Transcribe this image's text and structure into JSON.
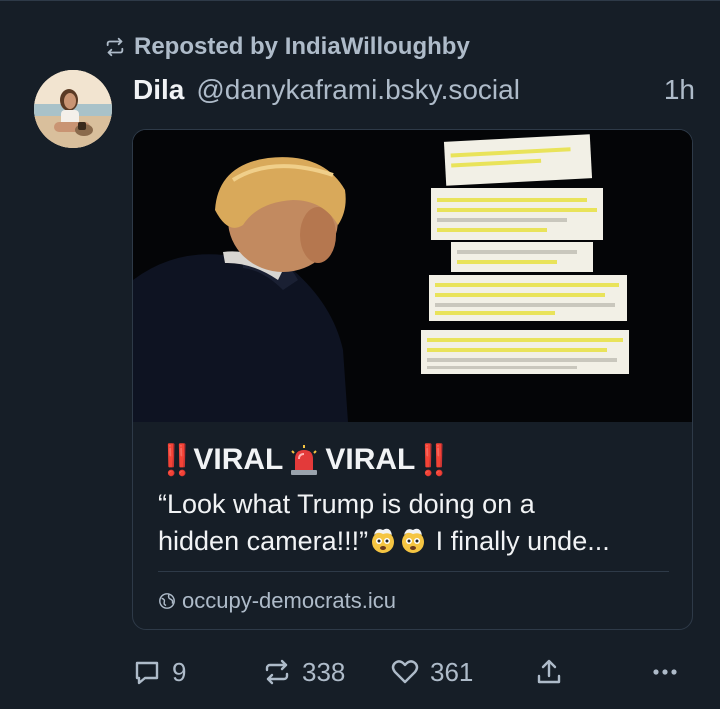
{
  "repost": {
    "label": "Reposted by IndiaWilloughby"
  },
  "author": {
    "name": "Dila",
    "handle": "@danykaframi.bsky.social",
    "time": "1h"
  },
  "card": {
    "title_bangs_left": "‼️",
    "title_word_1": "VIRAL",
    "title_word_2": "VIRAL",
    "title_bangs_right": "‼️",
    "description_line_1": "“Look what Trump is doing on a",
    "description_line_2_before_emoji": "hidden camera!!!”",
    "description_line_2_after_emoji": " I finally unde...",
    "link": "occupy-democrats.icu"
  },
  "actions": {
    "reply_count": "9",
    "repost_count": "338",
    "like_count": "361"
  },
  "colors": {
    "background": "#161e27",
    "border": "#2e3a48",
    "muted_text": "#aebbc9",
    "primary_text": "#f1f3f5",
    "alert_red": "#e0262b"
  }
}
